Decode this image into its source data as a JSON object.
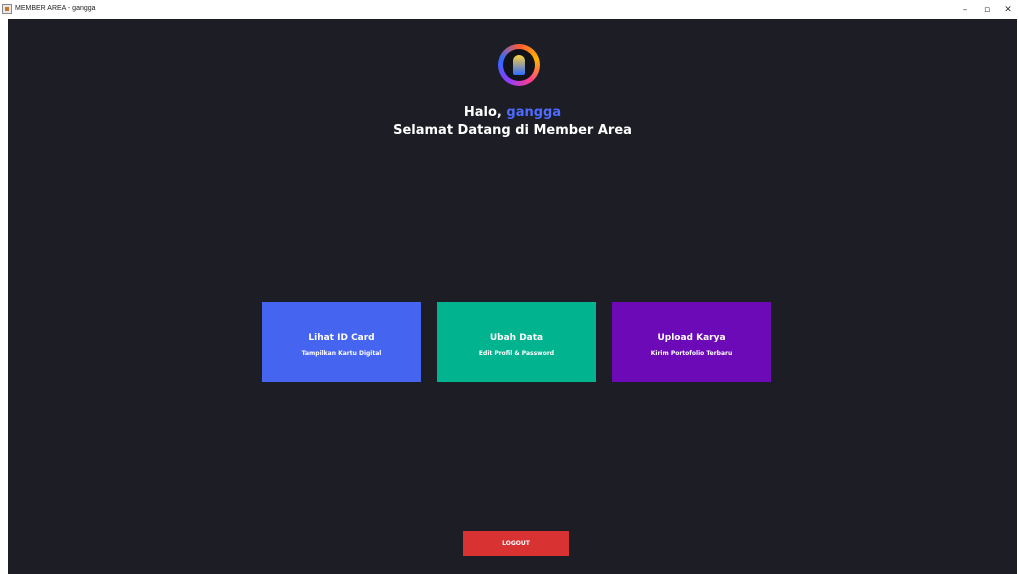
{
  "window": {
    "title": "MEMBER AREA - gangga",
    "minimize_glyph": "–",
    "maximize_glyph": "▫",
    "close_glyph": "✕"
  },
  "header": {
    "greeting_prefix": "Halo,",
    "username": "gangga",
    "welcome": "Selamat Datang di Member Area",
    "logo_icon": "member-logo-icon"
  },
  "cards": [
    {
      "title": "Lihat ID Card",
      "subtitle": "Tampilkan Kartu Digital",
      "color": "#4565f0"
    },
    {
      "title": "Ubah Data",
      "subtitle": "Edit Profil & Password",
      "color": "#02b38f"
    },
    {
      "title": "Upload Karya",
      "subtitle": "Kirim Portofolio Terbaru",
      "color": "#6c0ab8"
    }
  ],
  "logout": {
    "label": "LOGOUT",
    "color": "#d93232"
  },
  "colors": {
    "background": "#1c1d25",
    "username_accent": "#4d6bff"
  }
}
